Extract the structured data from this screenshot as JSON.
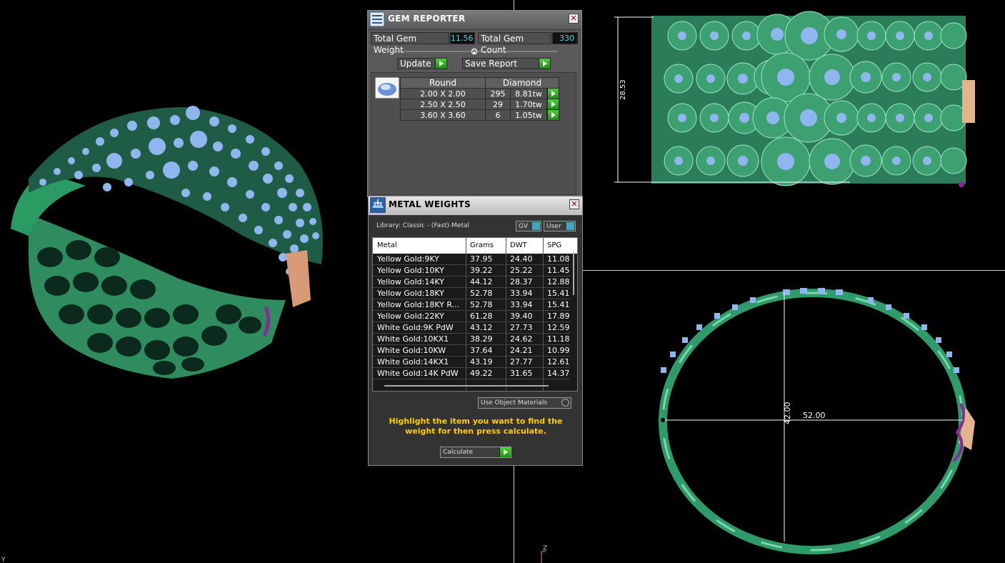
{
  "gem_reporter": {
    "title": "GEM REPORTER",
    "total_weight_label": "Total Gem Weight",
    "total_weight_value": "11.56",
    "total_count_label": "Total Gem Count",
    "total_count_value": "330",
    "update_label": "Update",
    "save_report_label": "Save Report",
    "table": {
      "shape_header": "Round",
      "material_header": "Diamond",
      "rows": [
        {
          "size": "2.00 X 2.00",
          "count": "295",
          "weight": "8.81tw"
        },
        {
          "size": "2.50 X 2.50",
          "count": "29",
          "weight": "1.70tw"
        },
        {
          "size": "3.60 X 3.60",
          "count": "6",
          "weight": "1.05tw"
        }
      ]
    }
  },
  "metal_weights": {
    "title": "METAL WEIGHTS",
    "library_label": "Library: Classic - (Fast)-Metal",
    "gv_label": "GV",
    "user_label": "User",
    "columns": [
      "Metal",
      "Grams",
      "DWT",
      "SPG"
    ],
    "rows": [
      {
        "metal": "Yellow Gold:9KY",
        "grams": "37.95",
        "dwt": "24.40",
        "spg": "11.08"
      },
      {
        "metal": "Yellow Gold:10KY",
        "grams": "39.22",
        "dwt": "25.22",
        "spg": "11.45"
      },
      {
        "metal": "Yellow Gold:14KY",
        "grams": "44.12",
        "dwt": "28.37",
        "spg": "12.88"
      },
      {
        "metal": "Yellow Gold:18KY",
        "grams": "52.78",
        "dwt": "33.94",
        "spg": "15.41"
      },
      {
        "metal": "Yellow Gold:18KY R...",
        "grams": "52.78",
        "dwt": "33.94",
        "spg": "15.41"
      },
      {
        "metal": "Yellow Gold:22KY",
        "grams": "61.28",
        "dwt": "39.40",
        "spg": "17.89"
      },
      {
        "metal": "White Gold:9K PdW",
        "grams": "43.12",
        "dwt": "27.73",
        "spg": "12.59"
      },
      {
        "metal": "White Gold:10KX1",
        "grams": "38.29",
        "dwt": "24.62",
        "spg": "11.18"
      },
      {
        "metal": "White Gold:10KW",
        "grams": "37.64",
        "dwt": "24.21",
        "spg": "10.99"
      },
      {
        "metal": "White Gold:14KX1",
        "grams": "43.19",
        "dwt": "27.77",
        "spg": "12.61"
      },
      {
        "metal": "White Gold:14K PdW",
        "grams": "49.22",
        "dwt": "31.65",
        "spg": "14.37"
      }
    ],
    "use_object_materials_label": "Use Object Materials",
    "instruction": "Highlight the item you want to find the weight for then press calculate.",
    "calculate_label": "Calculate"
  },
  "viewports": {
    "top_dimension": "28.53",
    "front_width": "52.00",
    "front_height": "42.00",
    "axis_z": "Z",
    "axis_y": "Y"
  },
  "colors": {
    "metal_green": "#2f9a6a",
    "gem_blue": "#8fb6ee",
    "panel_gray": "#595959",
    "value_cyan": "#55d6e0",
    "instruction_yellow": "#ffcc00"
  }
}
